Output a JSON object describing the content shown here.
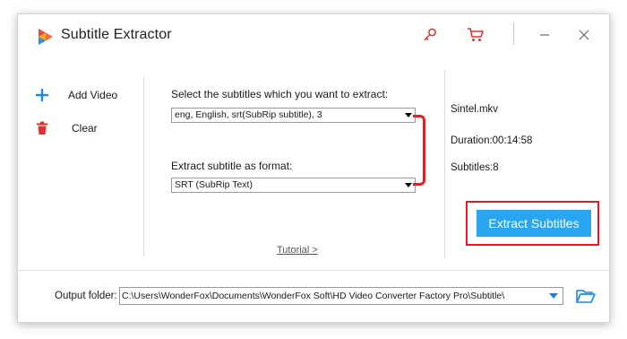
{
  "window": {
    "title": "Subtitle Extractor",
    "icons": [
      "logo-icon",
      "key-icon",
      "cart-icon",
      "minimize-icon",
      "close-icon"
    ]
  },
  "sidebar": {
    "add_video": "Add Video",
    "clear": "Clear"
  },
  "main": {
    "select_label": "Select the subtitles which you want to extract:",
    "subtitle_value": "eng, English, srt(SubRip subtitle), 3",
    "format_label": "Extract subtitle as format:",
    "format_value": "SRT (SubRip Text)",
    "tutorial": "Tutorial >"
  },
  "info": {
    "file_name": "Sintel.mkv",
    "duration": "Duration:00:14:58",
    "subtitles": "Subtitles:8"
  },
  "extract_button": "Extract Subtitles",
  "output": {
    "label": "Output folder:",
    "path": "C:\\Users\\WonderFox\\Documents\\WonderFox Soft\\HD Video Converter Factory Pro\\Subtitle\\"
  },
  "colors": {
    "accent": "#2aa6f0",
    "highlight": "#e8191f",
    "icon_red": "#e0302a",
    "icon_blue": "#1e88e5"
  }
}
